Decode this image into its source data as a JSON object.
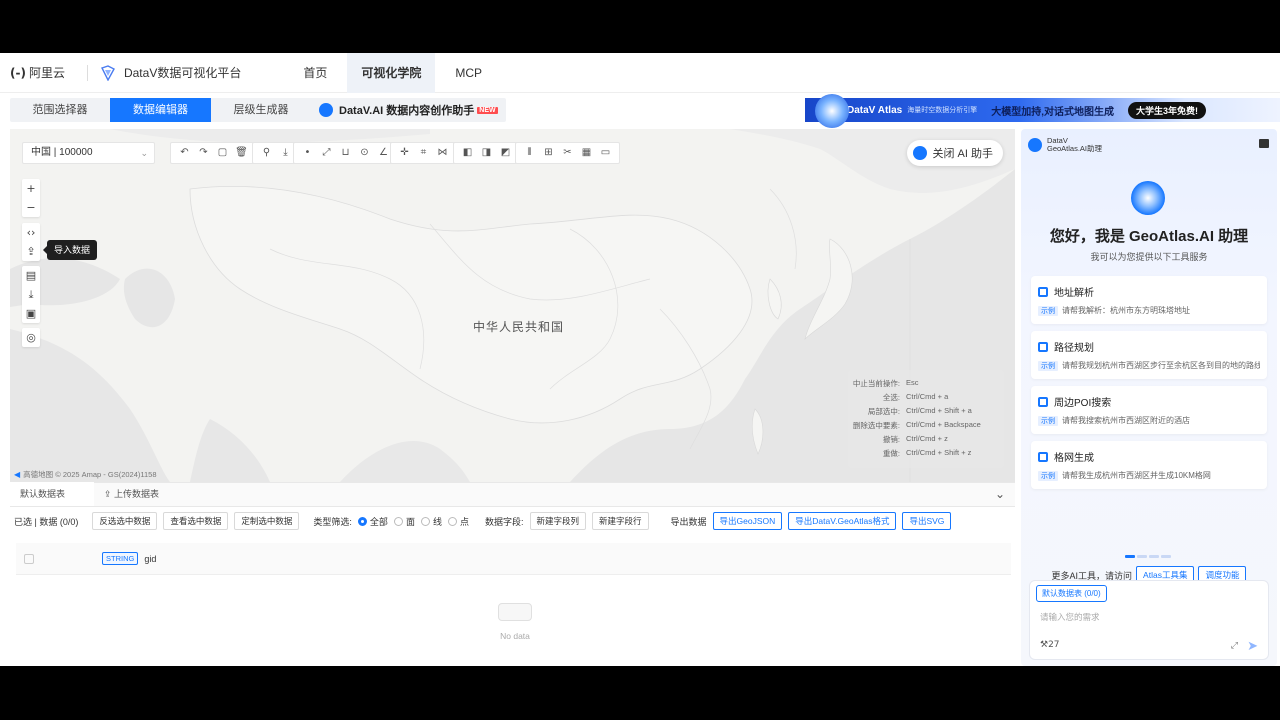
{
  "header": {
    "brand": "阿里云",
    "brand_mark": "(-)",
    "product": "DataV数据可视化平台",
    "nav": [
      "首页",
      "可视化学院",
      "MCP"
    ]
  },
  "tool_tabs": [
    "范围选择器",
    "数据编辑器",
    "层级生成器"
  ],
  "ai_tab": {
    "label": "DataV.AI 数据内容创作助手",
    "badge": "NEW"
  },
  "banner": {
    "title": "DataV Atlas",
    "subtitle": "海量时空数据分析引擎",
    "headline": "大模型加持,对话式地图生成",
    "cta": "大学生3年免费!"
  },
  "map": {
    "scale": "中国 | 100000",
    "ai_toggle": "关闭 AI 助手",
    "country_label": "中华人民共和国",
    "tooltip": "导入数据",
    "attribution": "高德地图 © 2025 Amap - GS(2024)1158",
    "shortcuts": [
      {
        "k": "中止当前操作:",
        "v": "Esc"
      },
      {
        "k": "全选:",
        "v": "Ctrl/Cmd + a"
      },
      {
        "k": "局部选中:",
        "v": "Ctrl/Cmd + Shift + a"
      },
      {
        "k": "删除选中要素:",
        "v": "Ctrl/Cmd + Backspace"
      },
      {
        "k": "撤销:",
        "v": "Ctrl/Cmd + z"
      },
      {
        "k": "重做:",
        "v": "Ctrl/Cmd + Shift + z"
      }
    ]
  },
  "bottom": {
    "tabs": [
      "默认数据表",
      "上传数据表"
    ],
    "selected": "已选 | 数据 (0/0)",
    "actions": [
      "反选选中数据",
      "查看选中数据",
      "定制选中数据"
    ],
    "type_filter": "类型筛选:",
    "type_options": [
      "全部",
      "面",
      "线",
      "点"
    ],
    "field_ops": "数据字段:",
    "field_buttons": [
      "新建字段列",
      "新建字段行"
    ],
    "export_label": "导出数据",
    "export_buttons": [
      "导出GeoJSON",
      "导出DataV.GeoAtlas格式",
      "导出SVG"
    ],
    "column_type": "STRING",
    "column_name": "gid",
    "empty": "No data"
  },
  "ai_panel": {
    "name_line1": "DataV",
    "name_line2": "GeoAtlas.AI助理",
    "greeting": "您好，我是 GeoAtlas.AI 助理",
    "sub": "我可以为您提供以下工具服务",
    "example_label": "示例",
    "cards": [
      {
        "title": "地址解析",
        "desc": "请帮我解析：杭州市东方明珠塔地址"
      },
      {
        "title": "路径规划",
        "desc": "请帮我规划杭州市西湖区步行至余杭区各到目的地的路线"
      },
      {
        "title": "周边POI搜索",
        "desc": "请帮我搜索杭州市西湖区附近的酒店"
      },
      {
        "title": "格网生成",
        "desc": "请帮我生成杭州市西湖区并生成10KM格网"
      }
    ],
    "more_prefix": "更多AI工具，请访问",
    "more_buttons": [
      "Atlas工具集",
      "调度功能"
    ],
    "dataset_tag": "默认数据表 (0/0)",
    "placeholder": "请输入您的需求",
    "credit": "27"
  }
}
